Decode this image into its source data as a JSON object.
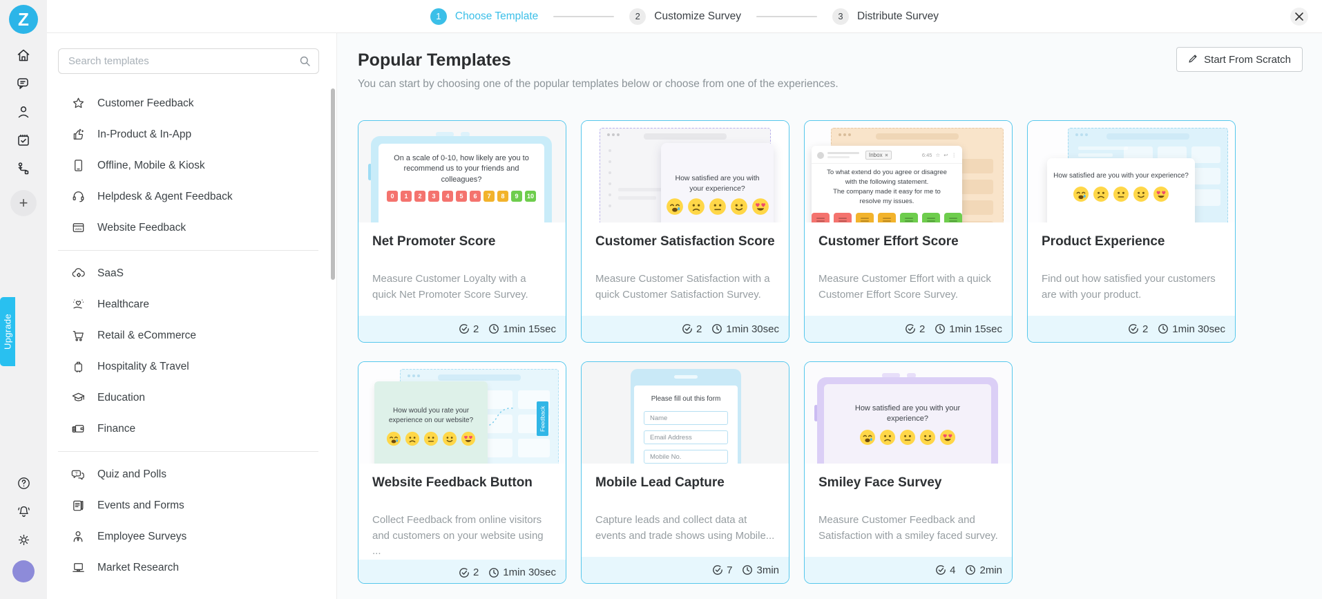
{
  "rail": {
    "plus_label": "+",
    "upgrade_label": "Upgrade",
    "nav_icons": [
      "home",
      "conversations",
      "contacts",
      "responses",
      "workflow"
    ],
    "bottom_icons": [
      "help",
      "notifications",
      "settings"
    ]
  },
  "header": {
    "steps": [
      {
        "num": "1",
        "label": "Choose Template",
        "active": true
      },
      {
        "num": "2",
        "label": "Customize Survey",
        "active": false
      },
      {
        "num": "3",
        "label": "Distribute Survey",
        "active": false
      }
    ]
  },
  "sidebar": {
    "search_placeholder": "Search templates",
    "sections": [
      {
        "items": [
          {
            "icon": "star",
            "label": "Customer Feedback"
          },
          {
            "icon": "inapp",
            "label": "In-Product & In-App"
          },
          {
            "icon": "kiosk",
            "label": "Offline, Mobile & Kiosk"
          },
          {
            "icon": "helpdesk",
            "label": "Helpdesk & Agent Feedback"
          },
          {
            "icon": "website",
            "label": "Website Feedback"
          }
        ]
      },
      {
        "items": [
          {
            "icon": "saas",
            "label": "SaaS"
          },
          {
            "icon": "healthcare",
            "label": "Healthcare"
          },
          {
            "icon": "retail",
            "label": "Retail & eCommerce"
          },
          {
            "icon": "hospitality",
            "label": "Hospitality & Travel"
          },
          {
            "icon": "education",
            "label": "Education"
          },
          {
            "icon": "finance",
            "label": "Finance"
          }
        ]
      },
      {
        "items": [
          {
            "icon": "quiz",
            "label": "Quiz and Polls"
          },
          {
            "icon": "events",
            "label": "Events and Forms"
          },
          {
            "icon": "employee",
            "label": "Employee Surveys"
          },
          {
            "icon": "market",
            "label": "Market Research"
          }
        ]
      }
    ]
  },
  "main": {
    "title": "Popular Templates",
    "subtitle": "You can start by choosing one of the popular templates below or choose from one of the experiences.",
    "start_from_scratch_label": "Start From Scratch"
  },
  "colors": {
    "accent_cyan": "#3bbfe8",
    "card_border": "#55c7ec",
    "footer_bg": "#e7f7fd",
    "nps_red": "#f4736e",
    "nps_yellow": "#f2b32c",
    "nps_green": "#6ecd4d"
  },
  "cards": [
    {
      "title": "Net Promoter Score",
      "description": "Measure Customer Loyalty with a quick Net Promoter Score Survey.",
      "responses": "2",
      "duration": "1min 15sec",
      "preview": {
        "kind": "nps-tablet",
        "question": "On a scale of 0-10, how likely are you to recommend us to your friends and colleagues?",
        "scale": [
          {
            "label": "0",
            "color": "#f4736e"
          },
          {
            "label": "1",
            "color": "#f4736e"
          },
          {
            "label": "2",
            "color": "#f4736e"
          },
          {
            "label": "3",
            "color": "#f4736e"
          },
          {
            "label": "4",
            "color": "#f4736e"
          },
          {
            "label": "5",
            "color": "#f4736e"
          },
          {
            "label": "6",
            "color": "#f4736e"
          },
          {
            "label": "7",
            "color": "#f2b32c"
          },
          {
            "label": "8",
            "color": "#f2b32c"
          },
          {
            "label": "9",
            "color": "#6ecd4d"
          },
          {
            "label": "10",
            "color": "#6ecd4d"
          }
        ]
      }
    },
    {
      "title": "Customer Satisfaction Score",
      "description": "Measure Customer Satisfaction with a quick Customer Satisfaction Survey.",
      "responses": "2",
      "duration": "1min 30sec",
      "preview": {
        "kind": "browser-popup",
        "theme": "purple",
        "question": "How satisfied are you with your experience?",
        "emojis": [
          "crying",
          "sad",
          "neutral",
          "happy",
          "love"
        ]
      }
    },
    {
      "title": "Customer Effort Score",
      "description": "Measure Customer Effort with a quick Customer Effort Score Survey.",
      "responses": "2",
      "duration": "1min 15sec",
      "preview": {
        "kind": "email-window",
        "tab_label": "Inbox",
        "time": "6:45",
        "question_lines": [
          "To what extend do you agree or disagree",
          "with the following statement.",
          "The company made it easy for me to",
          "resolve my issues."
        ],
        "buttons": [
          "#f4736e",
          "#f4736e",
          "#f2b32c",
          "#f2b32c",
          "#6ecd4d",
          "#6ecd4d",
          "#6ecd4d"
        ]
      }
    },
    {
      "title": "Product Experience",
      "description": "Find out how satisfied your customers are with your product.",
      "responses": "2",
      "duration": "1min 30sec",
      "preview": {
        "kind": "browser-popup",
        "theme": "cyan",
        "question": "How satisfied are you with your experience?",
        "emojis": [
          "crying",
          "sad",
          "neutral",
          "happy",
          "love"
        ]
      }
    },
    {
      "title": "Website Feedback Button",
      "description": "Collect Feedback from online visitors and customers on your website using ...",
      "responses": "2",
      "duration": "1min 30sec",
      "preview": {
        "kind": "website-feedback",
        "tab_label": "Feedback",
        "question": "How would you rate your experience on our website?",
        "emojis": [
          "crying",
          "sad",
          "neutral",
          "happy",
          "love"
        ]
      }
    },
    {
      "title": "Mobile Lead Capture",
      "description": "Capture leads and collect data at events and trade shows using Mobile...",
      "responses": "7",
      "duration": "3min",
      "preview": {
        "kind": "mobile-form",
        "question": "Please fill out this form",
        "fields": [
          "Name",
          "Email Address",
          "Mobile No."
        ]
      }
    },
    {
      "title": "Smiley Face Survey",
      "description": "Measure Customer Feedback and Satisfaction with a smiley faced survey.",
      "responses": "4",
      "duration": "2min",
      "preview": {
        "kind": "smiley-tablet",
        "question": "How satisfied are you with your experience?",
        "emojis": [
          "crying",
          "sad",
          "neutral",
          "happy",
          "love"
        ]
      }
    }
  ]
}
